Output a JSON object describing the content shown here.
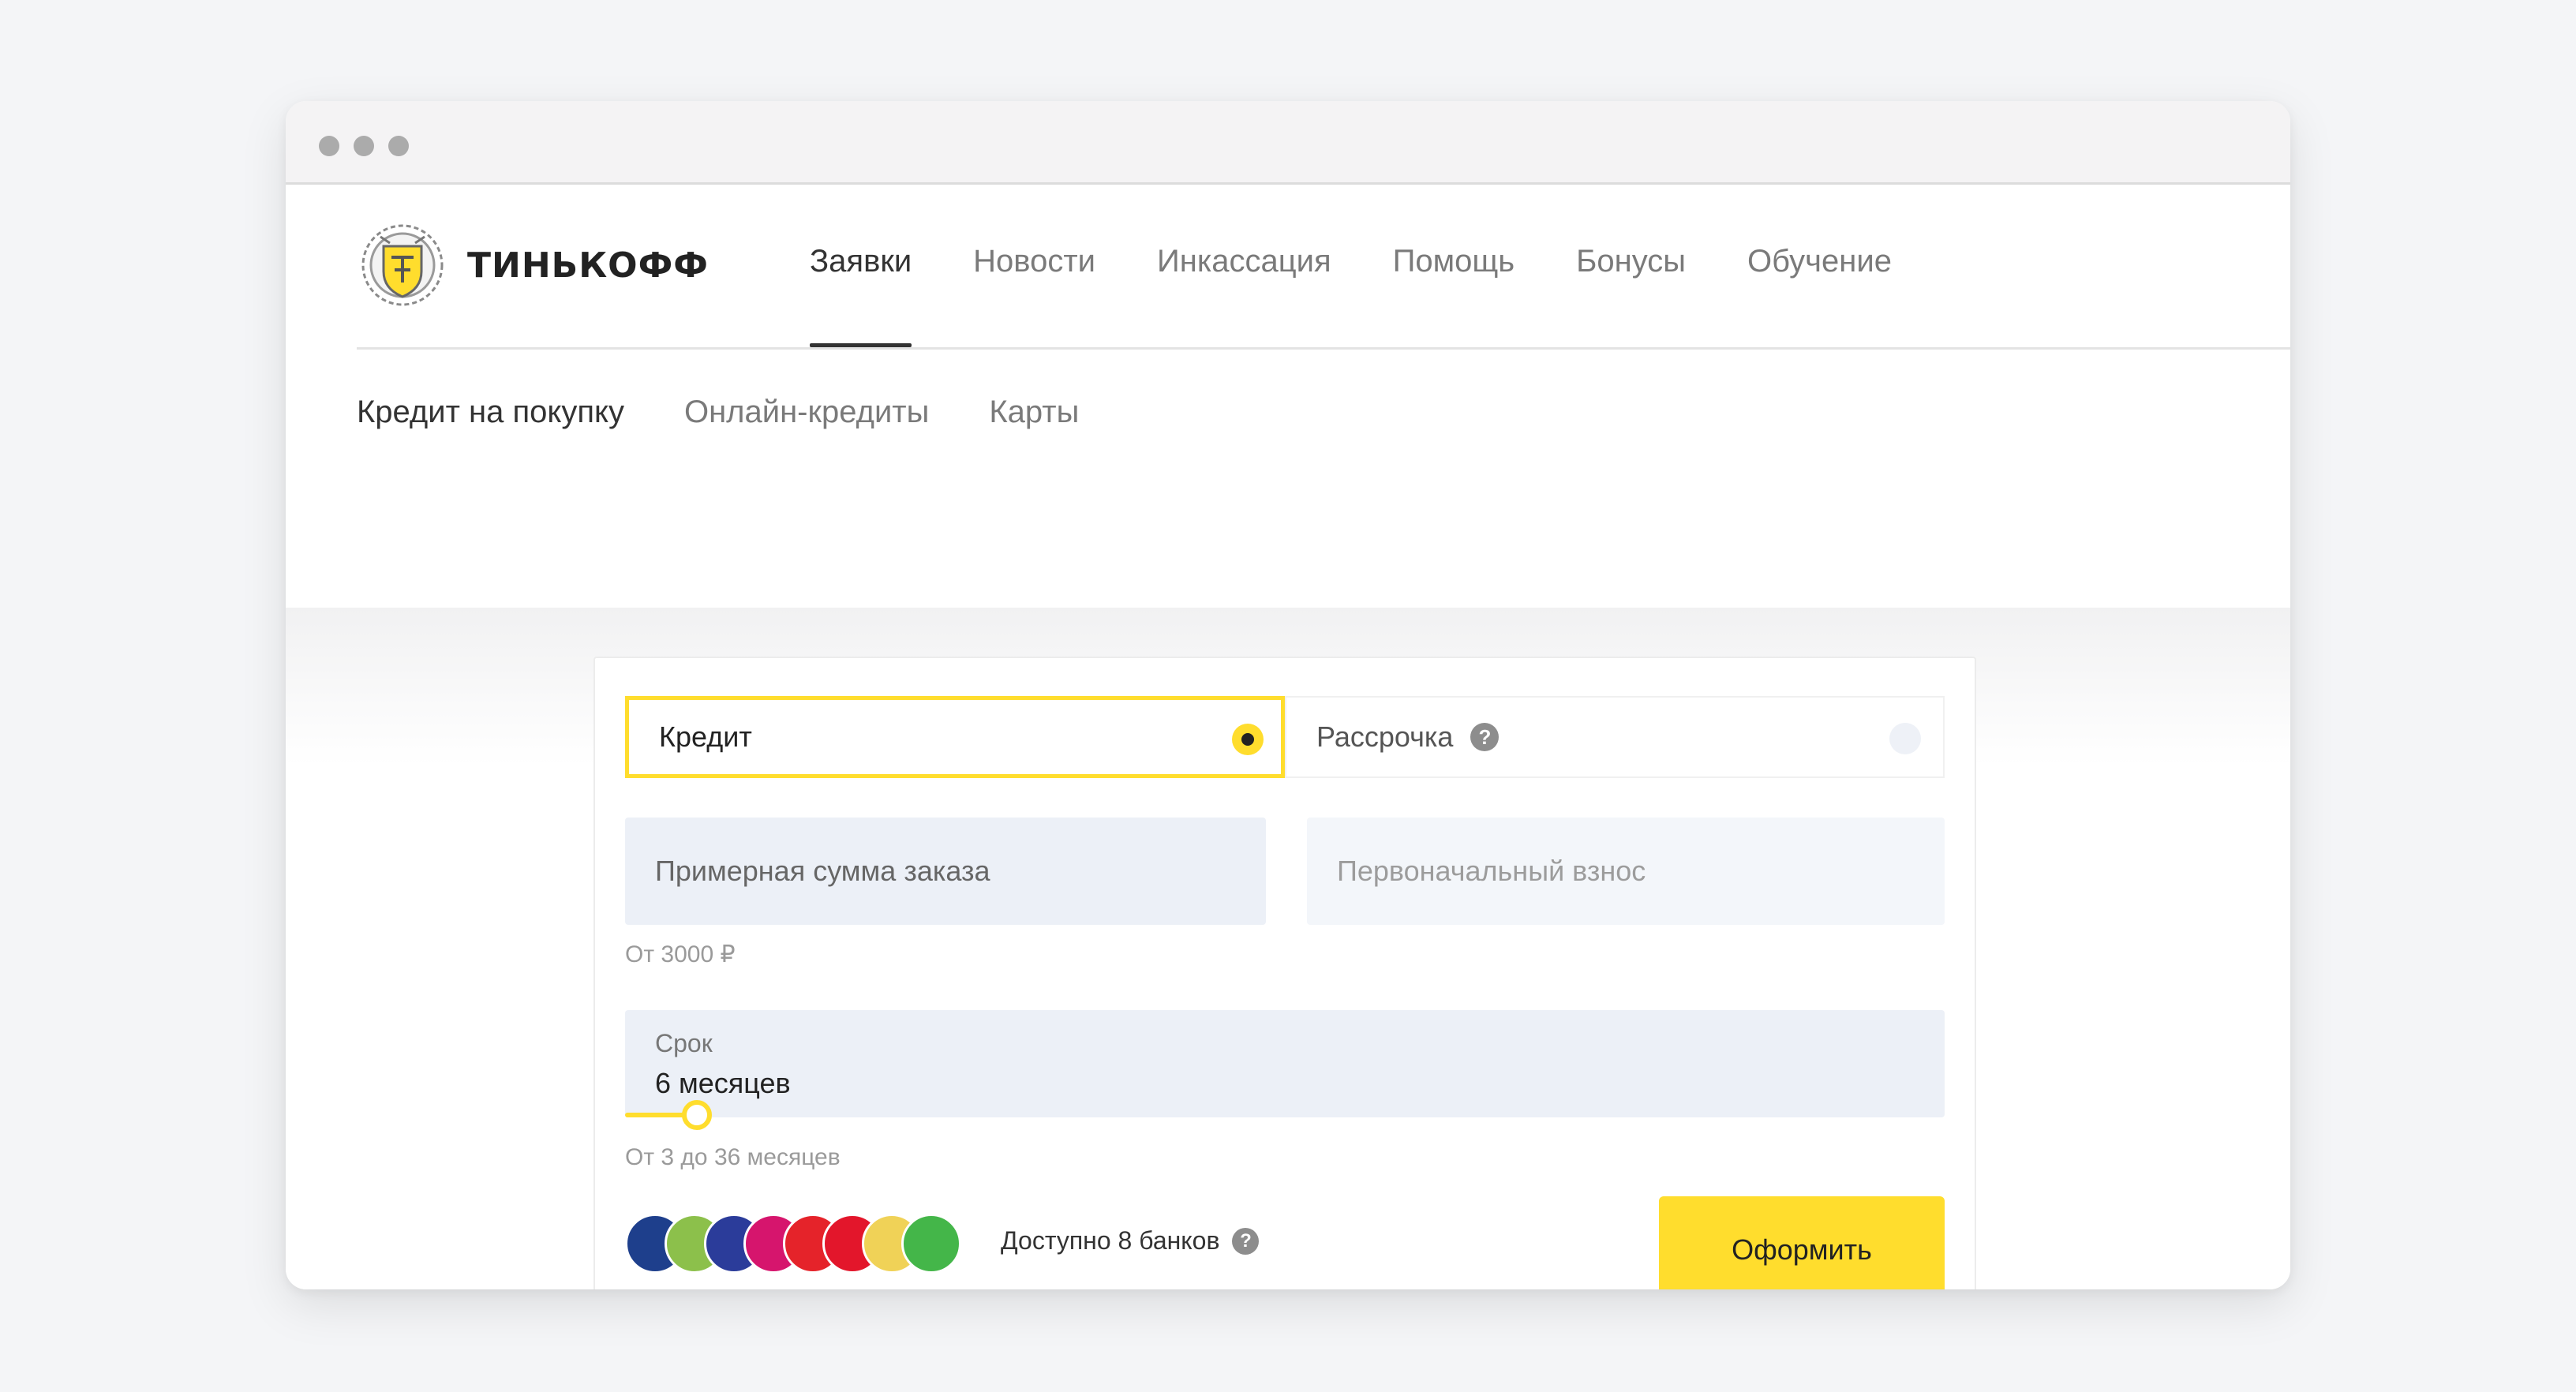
{
  "brand": {
    "name": "ТИНЬКОФФ"
  },
  "nav": {
    "items": [
      {
        "label": "Заявки",
        "active": true
      },
      {
        "label": "Новости"
      },
      {
        "label": "Инкассация"
      },
      {
        "label": "Помощь"
      },
      {
        "label": "Бонусы"
      },
      {
        "label": "Обучение"
      }
    ]
  },
  "subnav": {
    "items": [
      {
        "label": "Кредит на покупку",
        "active": true
      },
      {
        "label": "Онлайн-кредиты"
      },
      {
        "label": "Карты"
      }
    ]
  },
  "form": {
    "tabs": [
      {
        "label": "Кредит",
        "selected": true
      },
      {
        "label": "Рассрочка",
        "help": "?"
      }
    ],
    "amount": {
      "placeholder": "Примерная сумма заказа",
      "hint": "От 3000 ₽"
    },
    "down_payment": {
      "placeholder": "Первоначальный взнос"
    },
    "term": {
      "label": "Срок",
      "value": "6 месяцев",
      "hint": "От 3 до 36 месяцев",
      "min": 3,
      "max": 36,
      "current": 6
    },
    "banks": {
      "icons": [
        "bank-1-icon",
        "bank-2-icon",
        "bank-3-icon",
        "bank-4-icon",
        "bank-5-icon",
        "bank-6-icon",
        "bank-7-icon",
        "bank-8-icon"
      ],
      "colors": [
        "#1e3f8c",
        "#8cc04b",
        "#2b3c9a",
        "#d6156d",
        "#e5232a",
        "#e3162b",
        "#f0d257",
        "#44b649"
      ],
      "available_text": "Доступно 8 банков",
      "help": "?"
    },
    "submit_label": "Оформить"
  },
  "colors": {
    "accent": "#ffdd2d",
    "field_bg": "#ecf0f7"
  }
}
